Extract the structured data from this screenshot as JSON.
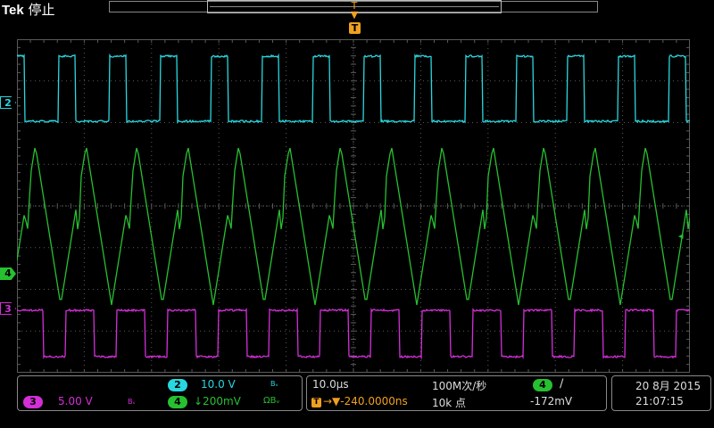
{
  "header": {
    "brand": "Tek",
    "state": "停止",
    "trigger_marker": "T"
  },
  "colors": {
    "ch2": "#29d7df",
    "ch3": "#d22fd6",
    "ch4": "#27c030",
    "trigger": "#f0a020",
    "grid": "#5a5a5a"
  },
  "channel_markers": {
    "ch2": "2",
    "ch4": "4",
    "ch3": "3"
  },
  "vertical": {
    "ch2": {
      "number": "2",
      "scale": "10.0 V",
      "bw": "Bᵥ"
    },
    "ch3": {
      "number": "3",
      "scale": "5.00 V",
      "bw": "Bᵥ"
    },
    "ch4": {
      "number": "4",
      "scale": "↓200mV",
      "coupling": "ΩBᵥ"
    }
  },
  "horizontal": {
    "time_per_div": "10.0μs",
    "sample_rate": "100M次/秒",
    "trigger_delay": "→▼-240.0000ns",
    "record_length": "10k 点",
    "trigger_source": "4",
    "trigger_slope": "∕",
    "trigger_level": "-172mV"
  },
  "datetime": {
    "date": "20 8月 2015",
    "time": "21:07:15"
  }
}
